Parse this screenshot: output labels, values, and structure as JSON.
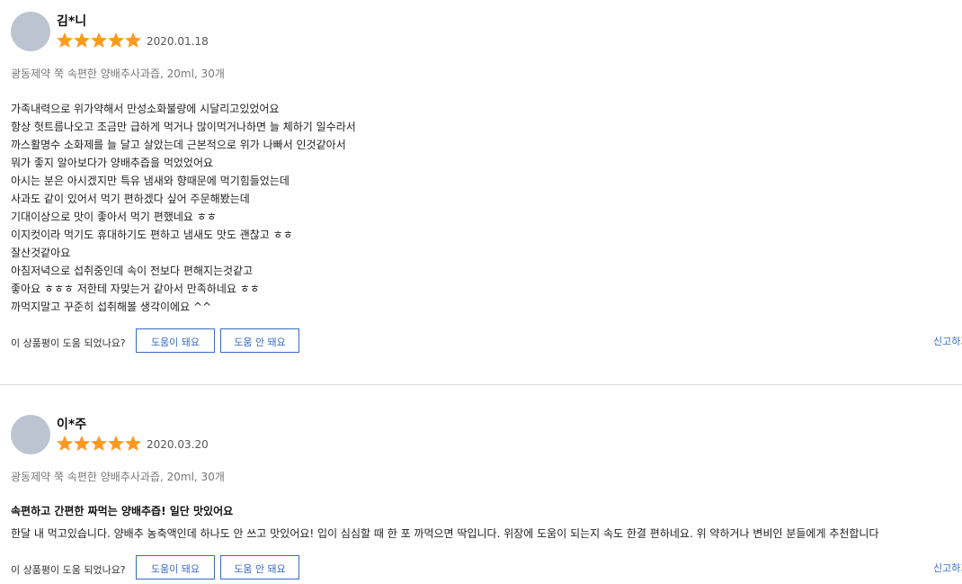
{
  "colors": {
    "star": "#ff9a1f",
    "accent": "#3a6bc4",
    "avatar": "#bcc3d1"
  },
  "reviews": [
    {
      "reviewer": "김*니",
      "rating": 5,
      "date": "2020.01.18",
      "product": "광동제약 쭉 속편한 양배추사과즙, 20ml, 30개",
      "headline": "",
      "body_lines": [
        "가족내력으로 위가약해서 만성소화불량에 시달리고있었어요",
        "항상 헛트름나오고 조금만 급하게 먹거나 많이먹거나하면 늘 체하기 일수라서",
        "까스활명수 소화제를 늘 달고 살았는데 근본적으로 위가 나빠서 인것같아서",
        "뭐가 좋지 알아보다가 양배추즙을 먹었었어요",
        "아시는 분은 아시겠지만 특유 냄새와 향때문에 먹기힘들었는데",
        "사과도 같이 있어서 먹기 편하겠다 싶어 주문해봤는데",
        "기대이상으로 맛이 좋아서 먹기 편했네요 ㅎㅎ",
        "이지컷이라 먹기도 휴대하기도 편하고 냄새도 맛도 괜찮고 ㅎㅎ",
        "잘산것같아요",
        "아침저녁으로 섭취중인데 속이 전보다 편해지는것같고",
        "좋아요 ㅎㅎㅎ 저한테 자맞는거 같아서 만족하네요 ㅎㅎ",
        "까먹지말고 꾸준히 섭취해볼 생각이에요 ^^"
      ],
      "helpful_question": "이 상품평이 도움 되었나요?",
      "helpful_yes": "도움이 돼요",
      "helpful_no": "도움 안 돼요",
      "report": "신고하기"
    },
    {
      "reviewer": "이*주",
      "rating": 5,
      "date": "2020.03.20",
      "product": "광동제약 쭉 속편한 양배추사과즙, 20ml, 30개",
      "headline": "속편하고 간편한 짜먹는 양배추즙! 일단 맛있어요",
      "body_lines": [
        "한달 내 먹고있습니다. 양배추 농축액인데 하나도 안 쓰고 맛있어요! 입이 심심할 때 한 포 까먹으면 딱입니다. 위장에 도움이 되는지 속도 한결 편하네요. 위 약하거나 변비인 분들에게 추천합니다"
      ],
      "helpful_question": "이 상품평이 도움 되었나요?",
      "helpful_yes": "도움이 돼요",
      "helpful_no": "도움 안 돼요",
      "report": "신고하기"
    }
  ]
}
